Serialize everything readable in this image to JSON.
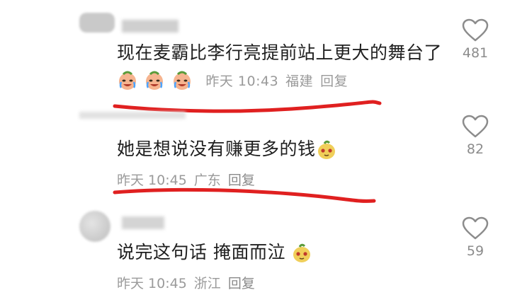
{
  "comments": [
    {
      "text": "现在麦霸比李行亮提前站上更大的舞台了",
      "emoji": [
        "crying-laugh-face-icon",
        "crying-laugh-face-icon",
        "crying-laugh-face-icon"
      ],
      "time": "昨天 10:43",
      "location": "福建",
      "reply_label": "回复",
      "like_count": "481"
    },
    {
      "text": "她是想说没有赚更多的钱",
      "emoji": [
        "doge-face-icon"
      ],
      "time": "昨天 10:45",
      "location": "广东",
      "reply_label": "回复",
      "like_count": "82"
    },
    {
      "text": "说完这句话 掩面而泣",
      "emoji": [
        "doge-face-icon"
      ],
      "time": "昨天 10:45",
      "location": "浙江",
      "reply_label": "回复",
      "like_count": "59"
    }
  ],
  "colors": {
    "underline": "#e02020",
    "text": "#1f1f1f",
    "meta": "#9a9a9a"
  }
}
